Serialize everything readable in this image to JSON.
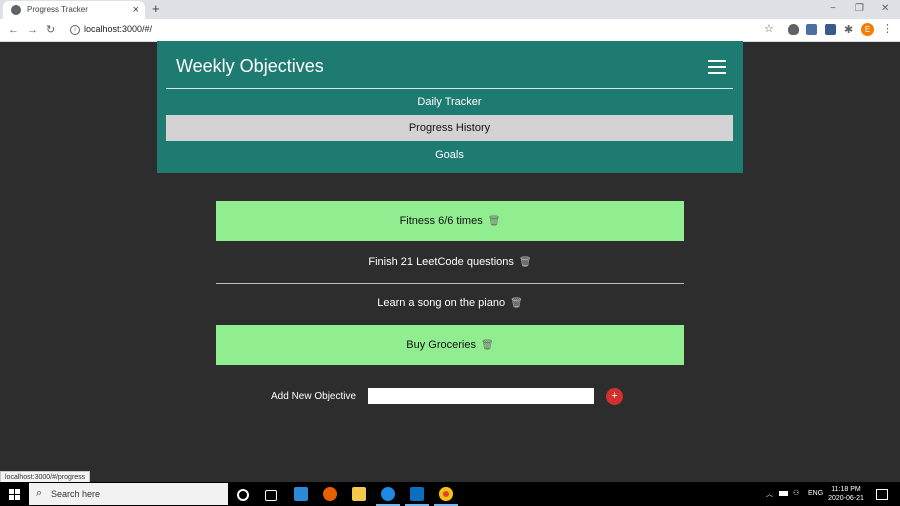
{
  "browser": {
    "tab_title": "Progress Tracker",
    "tab_close": "×",
    "new_tab": "+",
    "url": "localhost:3000/#/",
    "status_url": "localhost:3000/#/progress",
    "profile_initial": "E",
    "window_controls": [
      "−",
      "❐",
      "✕"
    ]
  },
  "app": {
    "title": "Weekly Objectives",
    "nav": [
      {
        "label": "Daily Tracker",
        "active": false
      },
      {
        "label": "Progress History",
        "active": true
      },
      {
        "label": "Goals",
        "active": false
      }
    ]
  },
  "objectives": [
    {
      "text": "Fitness 6/6 times",
      "completed": true
    },
    {
      "text": "Finish 21 LeetCode questions",
      "completed": false
    },
    {
      "text": "Learn a song on the piano",
      "completed": false
    },
    {
      "text": "Buy Groceries",
      "completed": true
    }
  ],
  "add_form": {
    "label": "Add New Objective",
    "input_value": "",
    "button_label": "+"
  },
  "taskbar": {
    "search_placeholder": "Search here",
    "language": "ENG",
    "time": "11:18 PM",
    "date": "2020-06-21"
  },
  "colors": {
    "header_bg": "#1e7b72",
    "completed_bg": "#90ee90",
    "active_nav_bg": "#d3d3d3",
    "page_bg": "#2d2d2d",
    "add_button": "#d32f2f"
  }
}
